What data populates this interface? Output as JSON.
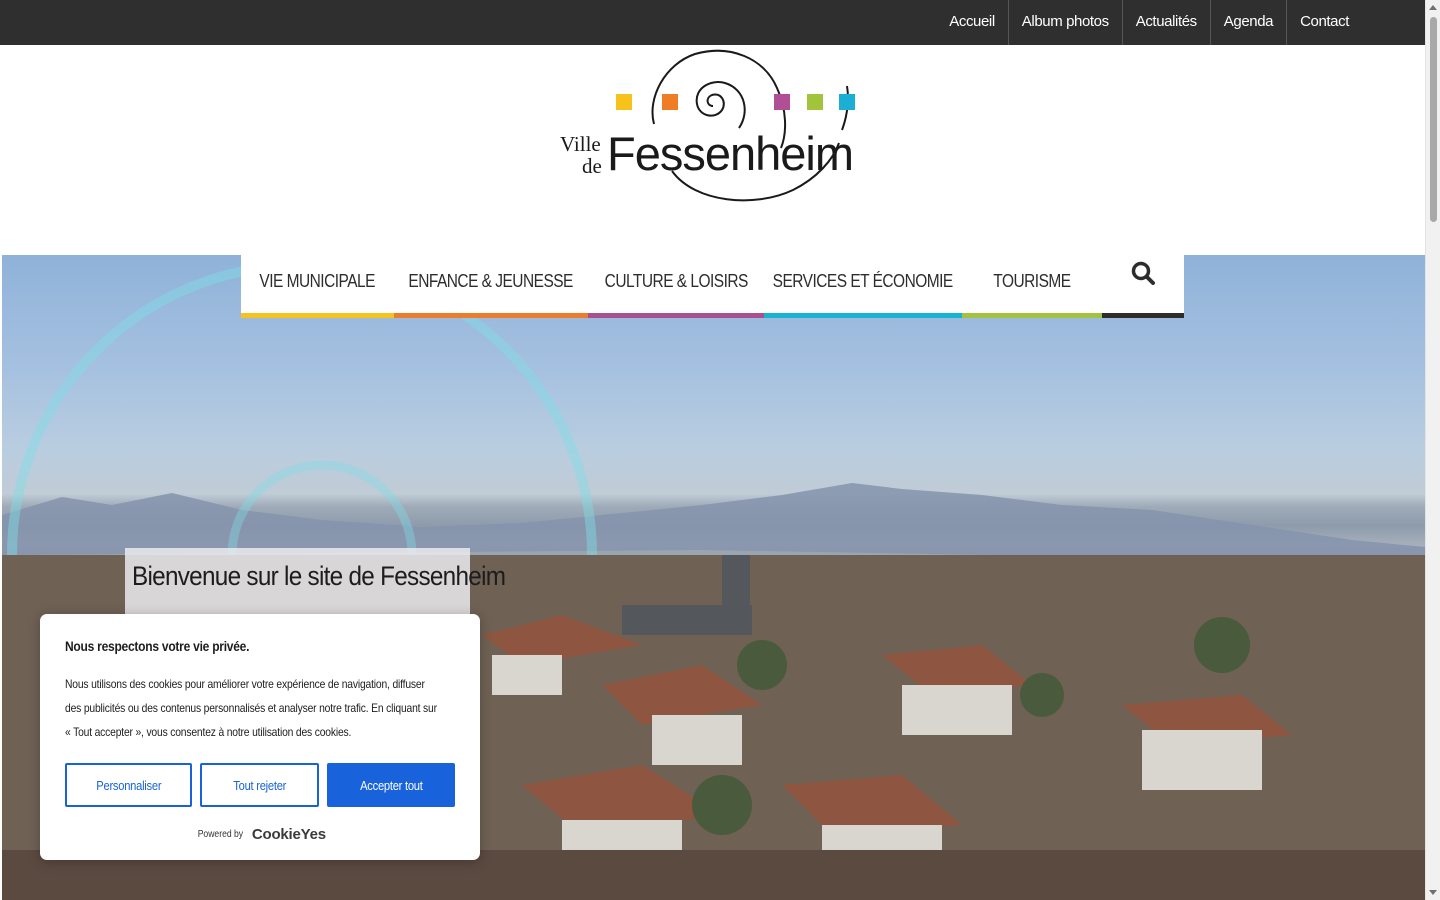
{
  "topnav": {
    "items": [
      "Accueil",
      "Album photos",
      "Actualités",
      "Agenda",
      "Contact"
    ]
  },
  "logo": {
    "line1": "Ville",
    "line2": "de",
    "name": "Fessenheim",
    "square_colors": [
      "#f7c31a",
      "#ef7d26",
      "#b04f95",
      "#a1c43a",
      "#1aafd3"
    ]
  },
  "mainnav": {
    "items": [
      {
        "label": "VIE MUNICIPALE",
        "color": "#f4c320"
      },
      {
        "label": "ENFANCE & JEUNESSE",
        "color": "#ee7d2b"
      },
      {
        "label": "CULTURE & LOISIRS",
        "color": "#a9508f"
      },
      {
        "label": "SERVICES ET ÉCONOMIE",
        "color": "#1ab2d2"
      },
      {
        "label": "TOURISME",
        "color": "#a3c23f"
      }
    ],
    "search_icon": "search-icon",
    "search_color": "#2d2d2d"
  },
  "hero": {
    "welcome_title": "Bienvenue sur le site de Fessenheim"
  },
  "cookie": {
    "title": "Nous respectons votre vie privée.",
    "description": "Nous utilisons des cookies pour améliorer votre expérience de navigation, diffuser des publicités ou des contenus personnalisés et analyser notre trafic. En cliquant sur « Tout accepter », vous consentez à notre utilisation des cookies.",
    "buttons": {
      "customize": "Personnaliser",
      "reject": "Tout rejeter",
      "accept": "Accepter tout"
    },
    "powered_by": "Powered by",
    "brand": "CookieYes",
    "accent_color": "#1863dc"
  }
}
